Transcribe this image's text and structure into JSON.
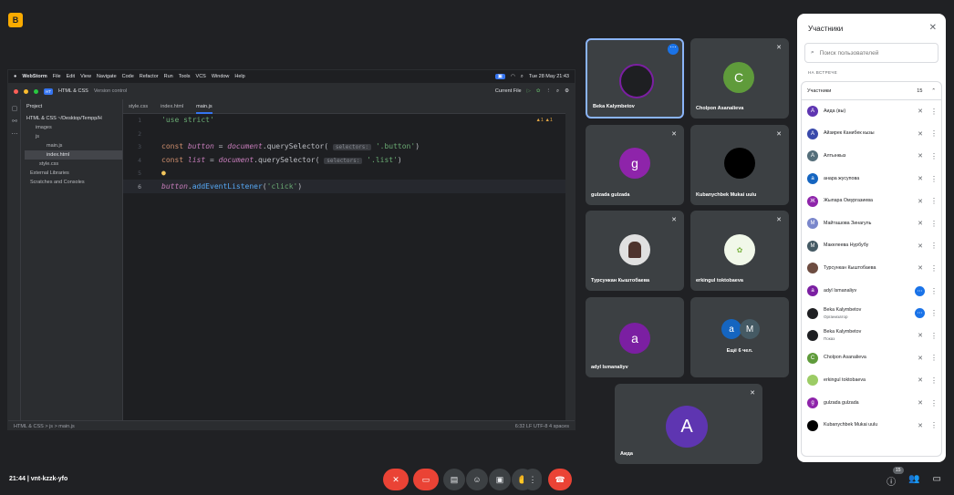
{
  "meet": {
    "logo_letter": "B",
    "meeting_time": "21:44",
    "meeting_code": "vnt-kzzk-yfo",
    "people_count": "15"
  },
  "ide": {
    "mac_app": "WebStorm",
    "mac_menu": [
      "File",
      "Edit",
      "View",
      "Navigate",
      "Code",
      "Refactor",
      "Run",
      "Tools",
      "VCS",
      "Window",
      "Help"
    ],
    "mac_clock": "Tue 28 May 21:43",
    "project_badge": "HT",
    "project_name": "HTML & CSS",
    "vcs_label": "Version control",
    "run_config": "Current File",
    "tabs": [
      "style.css",
      "index.html",
      "main.js"
    ],
    "project_header": "Project",
    "tree": [
      "HTML & CSS ~/Desktop/Tempp/H",
      "images",
      "js",
      "main.js",
      "index.html",
      "style.css",
      "External Libraries",
      "Scratches and Consoles"
    ],
    "line_numbers": [
      "1",
      "2",
      "3",
      "4",
      "5",
      "6"
    ],
    "code_line1": "'use strict'",
    "kw_const": "const",
    "var_button": "button",
    "var_list": "list",
    "eq": " = ",
    "document": "document",
    "qs": ".querySelector(",
    "hint": "selectors:",
    "str_button": "'.button'",
    "str_list": "'.list'",
    "close_paren": ")",
    "line6_obj": "button",
    "line6_dot": ".",
    "line6_fn": "addEventListener",
    "line6_open": "(",
    "line6_str": "'click'",
    "line6_close": ")",
    "warnings": "▲1 ▲1",
    "breadcrumb": "HTML & CSS  >  js  >  main.js",
    "status_right": "6:32   LF   UTF-8   4 spaces"
  },
  "tiles": [
    {
      "name": "Beka Kalymbetov",
      "avatar": "",
      "color": "#1e1f22"
    },
    {
      "name": "Cholpon Asanalieva",
      "avatar": "C",
      "color": "#5f9b3b"
    },
    {
      "name": "gulzada gulzada",
      "avatar": "g",
      "color": "#8e24aa"
    },
    {
      "name": "Kubanychbek Mukai uulu",
      "avatar": "",
      "color": "#000000"
    },
    {
      "name": "Турсункан Кыштобаева",
      "avatar": "",
      "color": "#e8e8e8"
    },
    {
      "name": "erkingul toktobaeva",
      "avatar": "",
      "color": "#e8e8e8"
    },
    {
      "name": "adyl Ismanaliyv",
      "avatar": "a",
      "color": "#7b1fa2"
    },
    {
      "name": "Ещё 6 чел.",
      "avatar": "",
      "color": "#3c4043"
    },
    {
      "name": "Аида",
      "avatar": "A",
      "color": "#5e35b1"
    }
  ],
  "others_avatars": [
    "a",
    "M"
  ],
  "panel": {
    "title": "Участники",
    "search_placeholder": "Поиск пользователей",
    "section": "НА ВСТРЕЧЕ",
    "group": "Участники",
    "group_count": "15",
    "people": [
      {
        "name": "Аида (вы)",
        "sub": "",
        "letter": "A",
        "color": "#5e35b1"
      },
      {
        "name": "Айзирек Канибек кызы",
        "sub": "",
        "letter": "A",
        "color": "#3949ab"
      },
      {
        "name": "Алтынкыз",
        "sub": "",
        "letter": "A",
        "color": "#546e7a"
      },
      {
        "name": "анара жусупова",
        "sub": "",
        "letter": "a",
        "color": "#1565c0"
      },
      {
        "name": "Жыпара Омургазиева",
        "sub": "",
        "letter": "Ж",
        "color": "#8e24aa"
      },
      {
        "name": "Майташова Зинагуль",
        "sub": "",
        "letter": "M",
        "color": "#7986cb"
      },
      {
        "name": "Макелеева Нурбубу",
        "sub": "",
        "letter": "M",
        "color": "#455a64"
      },
      {
        "name": "Турсункан Кыштобаева",
        "sub": "",
        "letter": "",
        "color": "#6d4c41"
      },
      {
        "name": "adyl Ismanaliyv",
        "sub": "",
        "letter": "a",
        "color": "#7b1fa2"
      },
      {
        "name": "Beka Kalymbetov",
        "sub": "Организатор",
        "letter": "",
        "color": "#1e1f22"
      },
      {
        "name": "Beka Kalymbetov",
        "sub": "Показ",
        "letter": "",
        "color": "#1e1f22"
      },
      {
        "name": "Cholpon Asanalieva",
        "sub": "",
        "letter": "C",
        "color": "#5f9b3b"
      },
      {
        "name": "erkingul toktobaeva",
        "sub": "",
        "letter": "",
        "color": "#9ccc65"
      },
      {
        "name": "gulzada gulzada",
        "sub": "",
        "letter": "g",
        "color": "#8e24aa"
      },
      {
        "name": "Kubanychbek Mukai uulu",
        "sub": "",
        "letter": "",
        "color": "#000000"
      }
    ]
  }
}
